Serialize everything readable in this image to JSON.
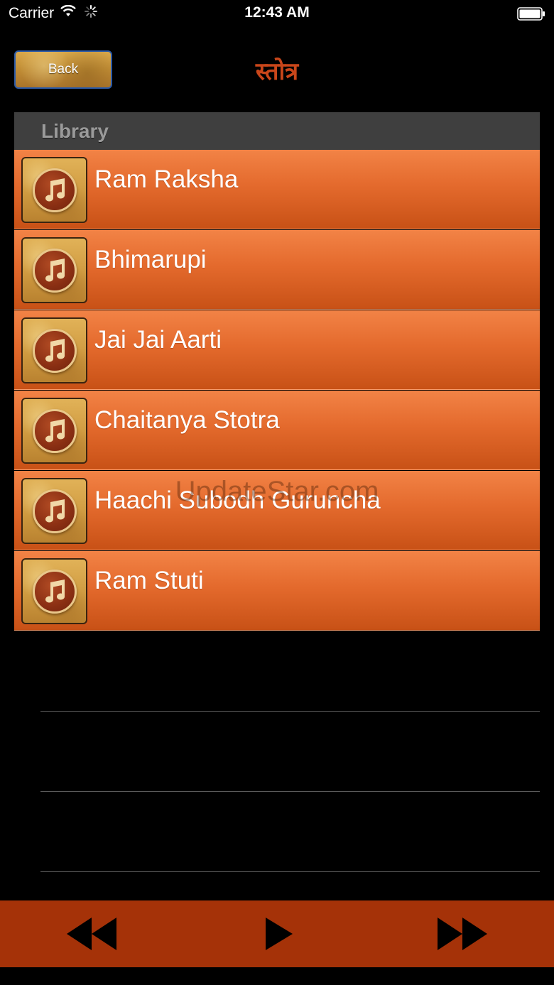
{
  "status_bar": {
    "carrier": "Carrier",
    "time": "12:43 AM",
    "wifi_icon": "wifi-icon",
    "activity_icon": "spinner-icon",
    "battery_icon": "battery-full-icon"
  },
  "nav": {
    "back_label": "Back",
    "title": "स्तोत्र"
  },
  "library": {
    "header": "Library",
    "tracks": [
      {
        "title": "Ram Raksha",
        "icon": "music-note-icon"
      },
      {
        "title": "Bhimarupi",
        "icon": "music-note-icon"
      },
      {
        "title": "Jai Jai Aarti",
        "icon": "music-note-icon"
      },
      {
        "title": "Chaitanya Stotra",
        "icon": "music-note-icon"
      },
      {
        "title": "Haachi Subodh Guruncha",
        "icon": "music-note-icon"
      },
      {
        "title": "Ram Stuti",
        "icon": "music-note-icon"
      }
    ]
  },
  "watermark": "UpdateStar.com",
  "player": {
    "rewind_icon": "rewind-icon",
    "play_icon": "play-icon",
    "forward_icon": "fast-forward-icon"
  },
  "colors": {
    "background": "#000000",
    "title_color": "#c9461a",
    "row_orange": "#e46a2d",
    "header_gray": "#3f3f3f",
    "player_bar": "#a53208"
  }
}
